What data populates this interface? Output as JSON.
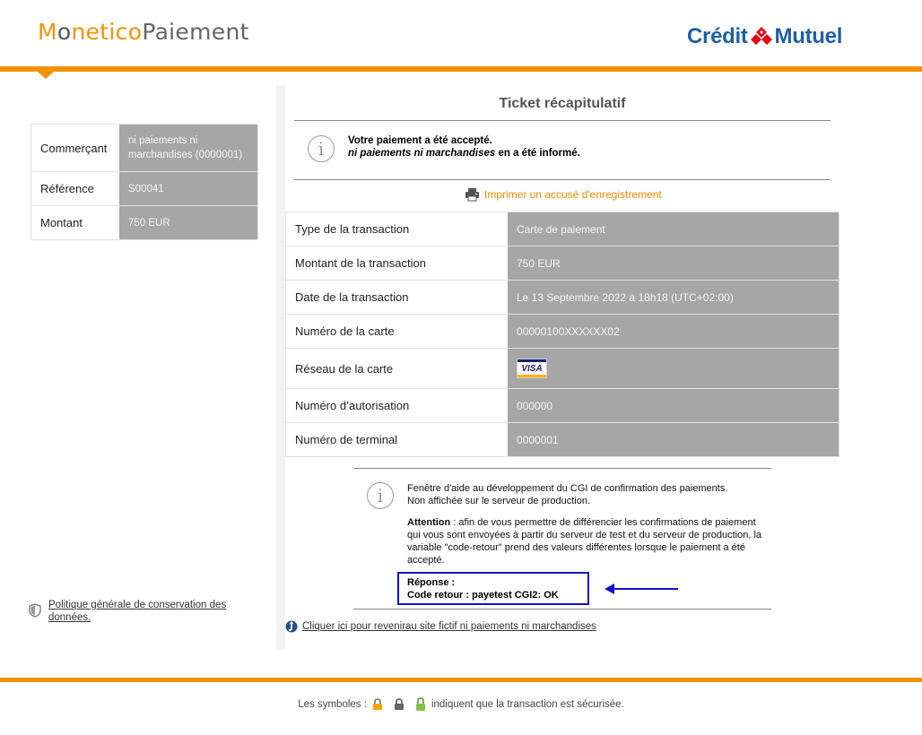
{
  "header": {
    "logo_monetico": [
      "M",
      "o",
      "netico",
      "Paiement"
    ],
    "logo_cm_left": "Crédit",
    "logo_cm_right": "Mutuel"
  },
  "summary": {
    "merchant_label": "Commerçant",
    "merchant_value": "ni paiements ni marchandises (0000001)",
    "reference_label": "Référence",
    "reference_value": "S00041",
    "amount_label": "Montant",
    "amount_value": "750 EUR"
  },
  "ticket": {
    "title": "Ticket récapitulatif",
    "accepted_msg": "Votre paiement a été accepté.",
    "merchant_name_italic": "ni paiements ni marchandises",
    "informed_suffix": " en a été informé.",
    "print_link": "Imprimer un accusé d'enregistrement"
  },
  "transaction": {
    "rows": [
      {
        "label": "Type de la transaction",
        "value": "Carte de paiement"
      },
      {
        "label": "Montant de la transaction",
        "value": "750 EUR"
      },
      {
        "label": "Date de la transaction",
        "value": "Le 13 Septembre 2022 à 18h18 (UTC+02:00)"
      },
      {
        "label": "Numéro de la carte",
        "value": "00000100XXXXXX02"
      },
      {
        "label": "Réseau de la carte",
        "value": "VISA"
      },
      {
        "label": "Numéro d’autorisation",
        "value": "000000"
      },
      {
        "label": "Numéro de terminal",
        "value": "0000001"
      }
    ]
  },
  "help": {
    "line1": "Fenêtre d'aide au développement du CGI de confirmation des paiements.",
    "line2": "Non affichée sur le serveur de production.",
    "attention_label": "Attention",
    "attention_text": " :  afin de vous permettre de différencier les confirmations de paiement qui vous sont envoyées à partir du serveur de test et du serveur de production, la variable \"code-retour\" prend des valeurs différentes lorsque le paiement a été accepté.",
    "response_label": "Réponse :",
    "response_code": "Code retour : payetest CGI2: OK"
  },
  "return_link": "Cliquer ici pour revenirau site fictif ni paiements ni marchandises",
  "policy_link": "Politique générale de conservation des données.",
  "footer": {
    "prefix": "Les symboles :",
    "suffix": "indiquent que la transaction est sécurisée."
  },
  "colors": {
    "accent_orange": "#f39200",
    "brand_blue": "#1d5fa8",
    "value_grey": "#a6a6a6",
    "response_border": "#1010cc"
  }
}
